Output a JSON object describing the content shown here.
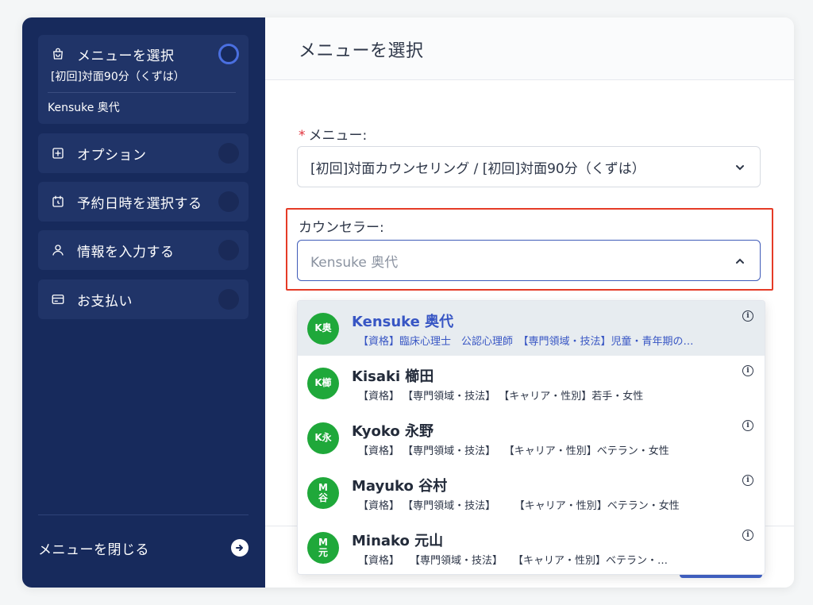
{
  "sidebar": {
    "steps": [
      {
        "label": "メニューを選択",
        "sub1": "[初回]対面90分（くずは）",
        "sub2": "Kensuke 奥代"
      },
      {
        "label": "オプション"
      },
      {
        "label": "予約日時を選択する"
      },
      {
        "label": "情報を入力する"
      },
      {
        "label": "お支払い"
      }
    ],
    "close_label": "メニューを閉じる"
  },
  "main": {
    "title": "メニューを選択",
    "menu_label": "メニュー:",
    "menu_value": "[初回]対面カウンセリング /  [初回]対面90分（くずは）",
    "counselor_label": "カウンセラー:",
    "counselor_placeholder": "Kensuke 奥代"
  },
  "counselors": [
    {
      "initials": "K奥",
      "name": "Kensuke 奥代",
      "desc": "【資格】臨床心理士　公認心理師　【専門領域・技法】児童・青年期の…"
    },
    {
      "initials": "K櫛",
      "name": "Kisaki 櫛田",
      "desc": "【資格】 【専門領域・技法】 【キャリア・性別】若手・女性"
    },
    {
      "initials": "K永",
      "name": "Kyoko 永野",
      "desc": "【資格】 【専門領域・技法】　 【キャリア・性別】ベテラン・女性"
    },
    {
      "initials": "M\n谷",
      "name": "Mayuko 谷村",
      "desc": "【資格】 【専門領域・技法】　　 【キャリア・性別】ベテラン・女性"
    },
    {
      "initials": "M\n元",
      "name": "Minako 元山",
      "desc": "【資格】　　【専門領域・技法】　　【キャリア・性別】ベテラン・…"
    }
  ],
  "colors": {
    "sidebar": "#172a5c",
    "avatar": "#1fa83a",
    "accent": "#3856c4",
    "highlight": "#e53b26"
  }
}
